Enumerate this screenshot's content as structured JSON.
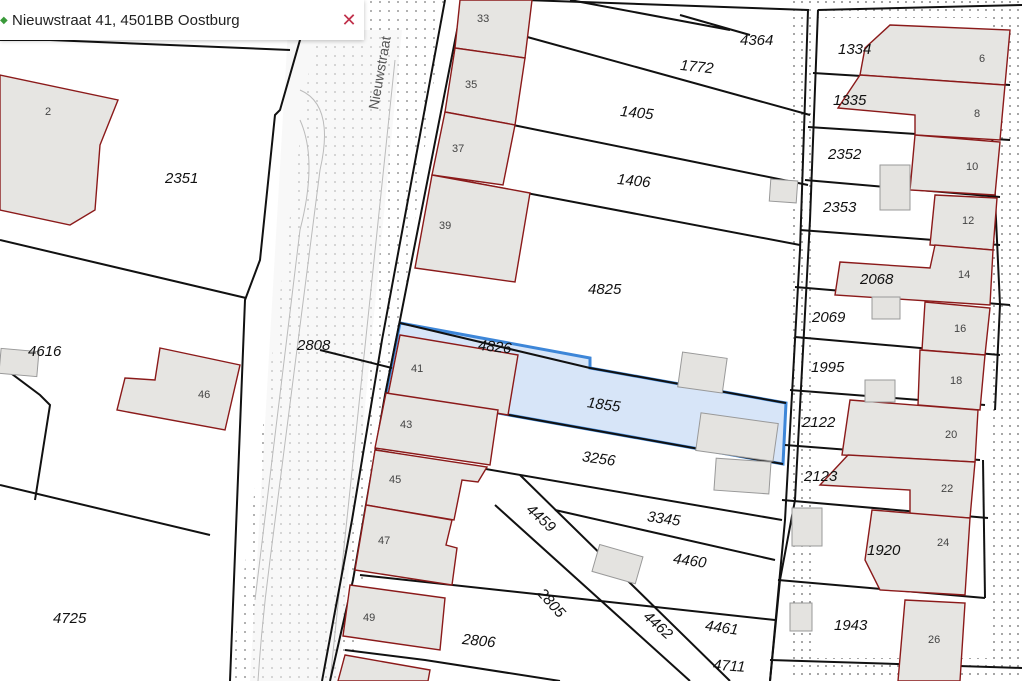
{
  "search": {
    "value": "Nieuwstraat 41, 4501BB Oostburg",
    "close_symbol": "✕",
    "marker_symbol": "◆"
  },
  "map": {
    "street_name": "Nieuwstraat",
    "selected_parcel": "1855",
    "parcel_numbers": {
      "p1772": "1772",
      "p4364": "4364",
      "p1405": "1405",
      "p1406": "1406",
      "p4825": "4825",
      "p4826": "4826",
      "p1855": "1855",
      "p3256": "3256",
      "p3345": "3345",
      "p4459": "4459",
      "p4460": "4460",
      "p2805": "2805",
      "p4462": "4462",
      "p4461": "4461",
      "p2806": "2806",
      "p4711": "4711",
      "p2351": "2351",
      "p4616": "4616",
      "p2808": "2808",
      "p4725": "4725",
      "p1334": "1334",
      "p1335": "1335",
      "p2352": "2352",
      "p2353": "2353",
      "p2068": "2068",
      "p2069": "2069",
      "p1995": "1995",
      "p2122": "2122",
      "p2123": "2123",
      "p1920": "1920",
      "p1943": "1943"
    },
    "house_numbers": {
      "h33": "33",
      "h35": "35",
      "h37": "37",
      "h39": "39",
      "h41": "41",
      "h43": "43",
      "h45": "45",
      "h47": "47",
      "h49": "49",
      "h2": "2",
      "h46": "46",
      "h6": "6",
      "h8": "8",
      "h10": "10",
      "h12": "12",
      "h14": "14",
      "h16": "16",
      "h18": "18",
      "h20": "20",
      "h22": "22",
      "h24": "24",
      "h26": "26"
    },
    "colors": {
      "selection_fill": "#c9dcf5",
      "selection_stroke": "#3d86d8",
      "building_stroke": "#8b1a1a",
      "parcel_boundary": "#111111"
    }
  }
}
